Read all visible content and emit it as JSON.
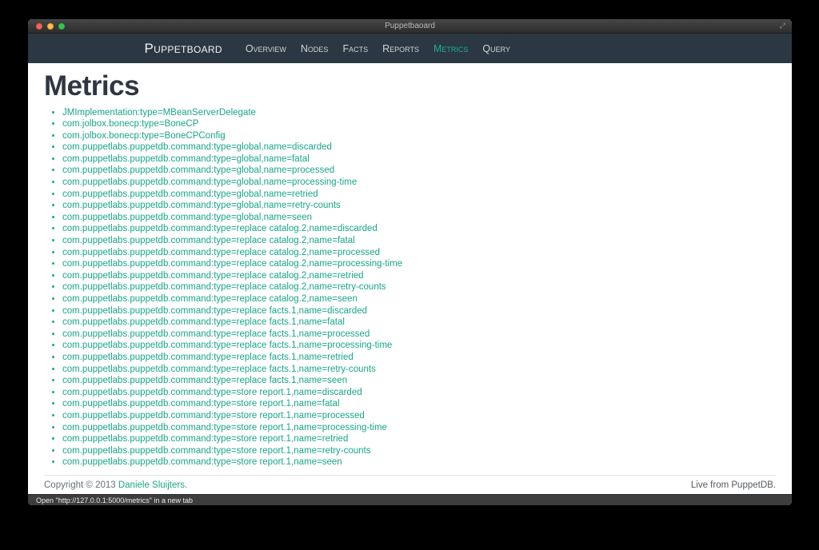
{
  "window": {
    "title": "Puppetbaoard",
    "status_bar": "Open \"http://127.0.0.1:5000/metrics\" in a new tab"
  },
  "navbar": {
    "brand": "Puppetboard",
    "items": [
      {
        "label": "Overview",
        "active": false
      },
      {
        "label": "Nodes",
        "active": false
      },
      {
        "label": "Facts",
        "active": false
      },
      {
        "label": "Reports",
        "active": false
      },
      {
        "label": "Metrics",
        "active": true
      },
      {
        "label": "Query",
        "active": false
      }
    ]
  },
  "page": {
    "title": "Metrics",
    "metrics": [
      "JMImplementation:type=MBeanServerDelegate",
      "com.jolbox.bonecp:type=BoneCP",
      "com.jolbox.bonecp:type=BoneCPConfig",
      "com.puppetlabs.puppetdb.command:type=global,name=discarded",
      "com.puppetlabs.puppetdb.command:type=global,name=fatal",
      "com.puppetlabs.puppetdb.command:type=global,name=processed",
      "com.puppetlabs.puppetdb.command:type=global,name=processing-time",
      "com.puppetlabs.puppetdb.command:type=global,name=retried",
      "com.puppetlabs.puppetdb.command:type=global,name=retry-counts",
      "com.puppetlabs.puppetdb.command:type=global,name=seen",
      "com.puppetlabs.puppetdb.command:type=replace catalog.2,name=discarded",
      "com.puppetlabs.puppetdb.command:type=replace catalog.2,name=fatal",
      "com.puppetlabs.puppetdb.command:type=replace catalog.2,name=processed",
      "com.puppetlabs.puppetdb.command:type=replace catalog.2,name=processing-time",
      "com.puppetlabs.puppetdb.command:type=replace catalog.2,name=retried",
      "com.puppetlabs.puppetdb.command:type=replace catalog.2,name=retry-counts",
      "com.puppetlabs.puppetdb.command:type=replace catalog.2,name=seen",
      "com.puppetlabs.puppetdb.command:type=replace facts.1,name=discarded",
      "com.puppetlabs.puppetdb.command:type=replace facts.1,name=fatal",
      "com.puppetlabs.puppetdb.command:type=replace facts.1,name=processed",
      "com.puppetlabs.puppetdb.command:type=replace facts.1,name=processing-time",
      "com.puppetlabs.puppetdb.command:type=replace facts.1,name=retried",
      "com.puppetlabs.puppetdb.command:type=replace facts.1,name=retry-counts",
      "com.puppetlabs.puppetdb.command:type=replace facts.1,name=seen",
      "com.puppetlabs.puppetdb.command:type=store report.1,name=discarded",
      "com.puppetlabs.puppetdb.command:type=store report.1,name=fatal",
      "com.puppetlabs.puppetdb.command:type=store report.1,name=processed",
      "com.puppetlabs.puppetdb.command:type=store report.1,name=processing-time",
      "com.puppetlabs.puppetdb.command:type=store report.1,name=retried",
      "com.puppetlabs.puppetdb.command:type=store report.1,name=retry-counts",
      "com.puppetlabs.puppetdb.command:type=store report.1,name=seen"
    ]
  },
  "footer": {
    "copyright_prefix": "Copyright © 2013 ",
    "copyright_link": "Daniele Sluijters",
    "copyright_suffix": ".",
    "right": "Live from PuppetDB."
  },
  "colors": {
    "accent_teal": "#18a689",
    "navbar_background": "#2b3844",
    "heading": "#2f3640",
    "statusbar_background": "#3d3d3d"
  }
}
